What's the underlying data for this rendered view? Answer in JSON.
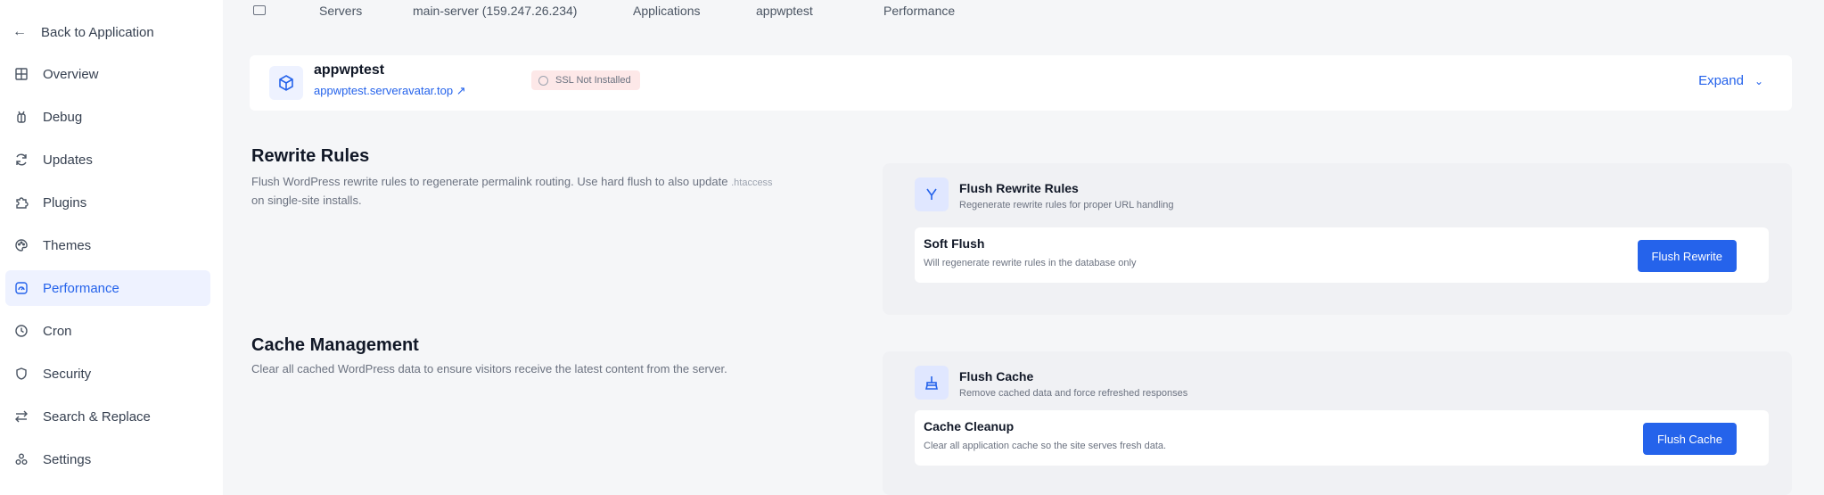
{
  "sidebar": {
    "back_label": "Back to Application",
    "items": [
      {
        "label": "Overview",
        "icon": "grid-icon"
      },
      {
        "label": "Debug",
        "icon": "bug-icon"
      },
      {
        "label": "Updates",
        "icon": "refresh-icon"
      },
      {
        "label": "Plugins",
        "icon": "puzzle-icon"
      },
      {
        "label": "Themes",
        "icon": "palette-icon"
      },
      {
        "label": "Performance",
        "icon": "gauge-icon",
        "active": true
      },
      {
        "label": "Cron",
        "icon": "clock-icon"
      },
      {
        "label": "Security",
        "icon": "shield-icon"
      },
      {
        "label": "Search & Replace",
        "icon": "swap-icon"
      },
      {
        "label": "Settings",
        "icon": "cog-icon"
      }
    ]
  },
  "breadcrumb": {
    "items": [
      "Servers",
      "main-server (159.247.26.234)",
      "Applications",
      "appwptest",
      "Performance"
    ]
  },
  "app": {
    "name": "appwptest",
    "url": "appwptest.serveravatar.top",
    "url_arrow": "↗",
    "badge": "SSL Not Installed",
    "expand_label": "Expand",
    "expand_chevron": "⌄"
  },
  "rewrite": {
    "title": "Rewrite Rules",
    "desc": "Flush WordPress rewrite rules to regenerate permalink routing. Use hard flush to also update",
    "desc_muted": ".htaccess",
    "desc_line2": "on single-site installs.",
    "panel_title": "Flush Rewrite Rules",
    "panel_sub": "Regenerate rewrite rules for proper URL handling",
    "row_title": "Soft Flush",
    "row_sub": "Will regenerate rewrite rules in the database only",
    "button": "Flush Rewrite"
  },
  "cache": {
    "title": "Cache Management",
    "desc": "Clear all cached WordPress data to ensure visitors receive the latest content from the server.",
    "panel_title": "Flush Cache",
    "panel_sub": "Remove cached data and force refreshed responses",
    "row_title": "Cache Cleanup",
    "row_sub": "Clear all application cache so the site serves fresh data.",
    "button": "Flush Cache"
  },
  "colors": {
    "accent": "#2563eb",
    "active_bg": "#eef2ff",
    "badge_bg": "#fde8e8"
  }
}
